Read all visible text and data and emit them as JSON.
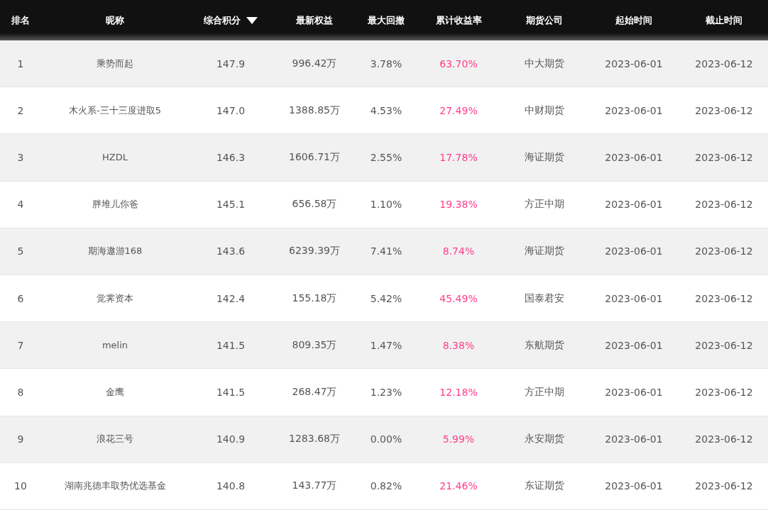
{
  "table": {
    "columns": [
      {
        "label": "排名",
        "sorted": false
      },
      {
        "label": "昵称",
        "sorted": false
      },
      {
        "label": "综合积分",
        "sorted": true
      },
      {
        "label": "最新权益",
        "sorted": false
      },
      {
        "label": "最大回撤",
        "sorted": false
      },
      {
        "label": "累计收益率",
        "sorted": false
      },
      {
        "label": "期货公司",
        "sorted": false
      },
      {
        "label": "起始时间",
        "sorted": false
      },
      {
        "label": "截止时间",
        "sorted": false
      }
    ],
    "rows": [
      {
        "rank": "1",
        "name": "乘势而起",
        "score": "147.9",
        "equity": "996.42万",
        "drawdown": "3.78%",
        "return": "63.70%",
        "company": "中大期货",
        "start": "2023-06-01",
        "end": "2023-06-12"
      },
      {
        "rank": "2",
        "name": "木火系-三十三度进取5",
        "score": "147.0",
        "equity": "1388.85万",
        "drawdown": "4.53%",
        "return": "27.49%",
        "company": "中财期货",
        "start": "2023-06-01",
        "end": "2023-06-12"
      },
      {
        "rank": "3",
        "name": "HZDL",
        "score": "146.3",
        "equity": "1606.71万",
        "drawdown": "2.55%",
        "return": "17.78%",
        "company": "海证期货",
        "start": "2023-06-01",
        "end": "2023-06-12"
      },
      {
        "rank": "4",
        "name": "胖堆儿你爸",
        "score": "145.1",
        "equity": "656.58万",
        "drawdown": "1.10%",
        "return": "19.38%",
        "company": "方正中期",
        "start": "2023-06-01",
        "end": "2023-06-12"
      },
      {
        "rank": "5",
        "name": "期海遨游168",
        "score": "143.6",
        "equity": "6239.39万",
        "drawdown": "7.41%",
        "return": "8.74%",
        "company": "海证期货",
        "start": "2023-06-01",
        "end": "2023-06-12"
      },
      {
        "rank": "6",
        "name": "觉霁资本",
        "score": "142.4",
        "equity": "155.18万",
        "drawdown": "5.42%",
        "return": "45.49%",
        "company": "国泰君安",
        "start": "2023-06-01",
        "end": "2023-06-12"
      },
      {
        "rank": "7",
        "name": "melin",
        "score": "141.5",
        "equity": "809.35万",
        "drawdown": "1.47%",
        "return": "8.38%",
        "company": "东航期货",
        "start": "2023-06-01",
        "end": "2023-06-12"
      },
      {
        "rank": "8",
        "name": "金鹰",
        "score": "141.5",
        "equity": "268.47万",
        "drawdown": "1.23%",
        "return": "12.18%",
        "company": "方正中期",
        "start": "2023-06-01",
        "end": "2023-06-12"
      },
      {
        "rank": "9",
        "name": "浪花三号",
        "score": "140.9",
        "equity": "1283.68万",
        "drawdown": "0.00%",
        "return": "5.99%",
        "company": "永安期货",
        "start": "2023-06-01",
        "end": "2023-06-12"
      },
      {
        "rank": "10",
        "name": "湖南兆德丰取势优选基金",
        "score": "140.8",
        "equity": "143.77万",
        "drawdown": "0.82%",
        "return": "21.46%",
        "company": "东证期货",
        "start": "2023-06-01",
        "end": "2023-06-12"
      }
    ]
  }
}
